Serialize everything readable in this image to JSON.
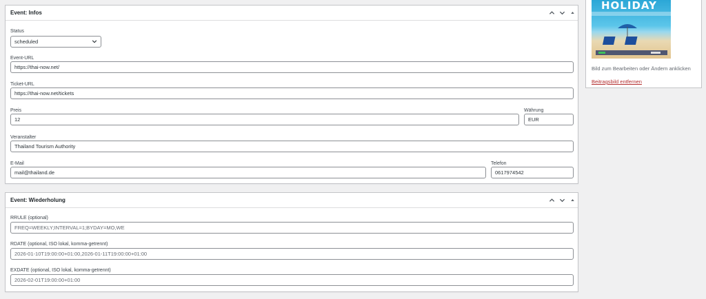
{
  "infos_box": {
    "title": "Event: Infos",
    "status": {
      "label": "Status",
      "value": "scheduled"
    },
    "event_url": {
      "label": "Event-URL",
      "value": "https://thai-now.net/"
    },
    "ticket_url": {
      "label": "Ticket-URL",
      "value": "https://thai-now.net/tickets"
    },
    "price": {
      "label": "Preis",
      "value": "12"
    },
    "currency": {
      "label": "Währung",
      "value": "EUR"
    },
    "organizer": {
      "label": "Veranstalter",
      "value": "Thailand Tourism Authority"
    },
    "email": {
      "label": "E-Mail",
      "value": "mail@thailand.de"
    },
    "phone": {
      "label": "Telefon",
      "value": "0617974542"
    }
  },
  "recurrence_box": {
    "title": "Event: Wiederholung",
    "rrule": {
      "label": "RRULE (optional)",
      "placeholder": "FREQ=WEEKLY;INTERVAL=1;BYDAY=MO,WE"
    },
    "rdate": {
      "label": "RDATE (optional, ISO lokal, komma-getrennt)",
      "placeholder": "2026-01-10T19:00:00+01:00,2026-01-11T19:00:00+01:00"
    },
    "exdate": {
      "label": "EXDATE (optional, ISO lokal, komma-getrennt)",
      "placeholder": "2026-02-01T19:00:00+01:00"
    }
  },
  "featured_image": {
    "thumb_text": "HOLIDAY",
    "hint": "Bild zum Bearbeiten oder Ändern anklicken",
    "remove_link": "Beitragsbild entfernen"
  },
  "colors": {
    "background": "#f0f0f1",
    "border": "#c3c4c7",
    "link_danger": "#b32d2e"
  }
}
